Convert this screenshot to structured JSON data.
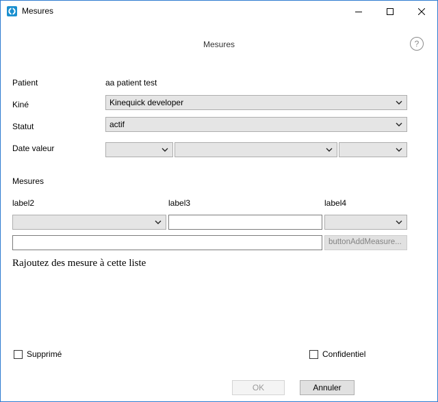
{
  "window": {
    "title": "Mesures"
  },
  "header": {
    "title": "Mesures",
    "help_symbol": "?"
  },
  "form": {
    "patient_label": "Patient",
    "patient_value": "aa patient test",
    "kine_label": "Kiné",
    "kine_value": "Kinequick developer",
    "statut_label": "Statut",
    "statut_value": "actif",
    "date_label": "Date valeur",
    "date_day": "",
    "date_month": "",
    "date_year": ""
  },
  "mesures": {
    "section_label": "Mesures",
    "label2": "label2",
    "label3": "label3",
    "label4": "label4",
    "combo2_value": "",
    "text3_value": "",
    "combo4_value": "",
    "text_full_value": "",
    "add_button_label": "buttonAddMeasure...",
    "empty_note": "Rajoutez des mesure à cette liste"
  },
  "footer": {
    "supprime_label": "Supprimé",
    "supprime_checked": false,
    "confidentiel_label": "Confidentiel",
    "confidentiel_checked": false,
    "ok_label": "OK",
    "cancel_label": "Annuler"
  },
  "colors": {
    "window_border": "#2b79d0",
    "app_icon": "#1a8fcf",
    "combo_bg": "#e5e5e5",
    "disabled_text": "#9a9a9a"
  },
  "icons": {
    "app": "app-logo-icon",
    "minimize": "minimize-icon",
    "maximize": "maximize-icon",
    "close": "close-icon",
    "help": "help-icon",
    "dropdown": "chevron-down-icon"
  }
}
